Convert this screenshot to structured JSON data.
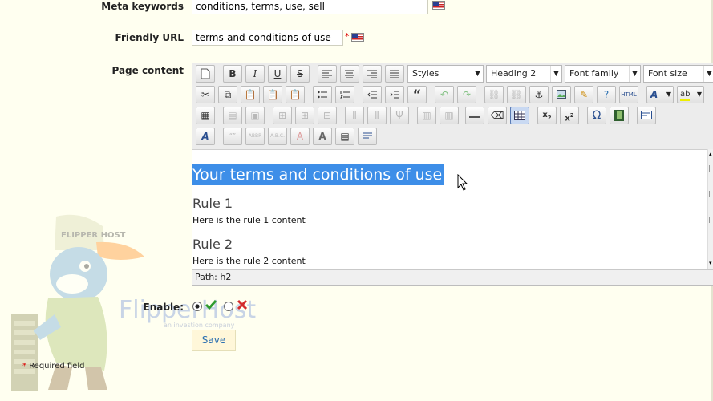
{
  "form": {
    "meta_keywords_label": "Meta keywords",
    "meta_keywords_value": "conditions, terms, use, sell",
    "friendly_url_label": "Friendly URL",
    "friendly_url_value": "terms-and-conditions-of-use",
    "required_star": "*",
    "page_content_label": "Page content",
    "enable_label": "Enable:",
    "enable_value": true,
    "save_label": "Save",
    "required_note": "Required field"
  },
  "editor": {
    "styles_dropdown": "Styles",
    "format_dropdown": "Heading 2",
    "font_family_dropdown": "Font family",
    "font_size_dropdown": "Font size",
    "heading": "Your terms and conditions of use",
    "rule1_title": "Rule 1",
    "rule1_text": "Here is the rule 1 content",
    "rule2_title": "Rule 2",
    "rule2_text": "Here is the rule 2 content",
    "path": "Path: h2"
  },
  "logo": {
    "brand": "FlipperHost",
    "tagline": "an investion company",
    "cap_text": "FLIPPER HOST"
  },
  "colors": {
    "selection": "#3d8ee8",
    "accept": "#2e9b2e",
    "reject": "#d42b2b",
    "save_text": "#2a6fb0",
    "background": "#fffff0"
  }
}
